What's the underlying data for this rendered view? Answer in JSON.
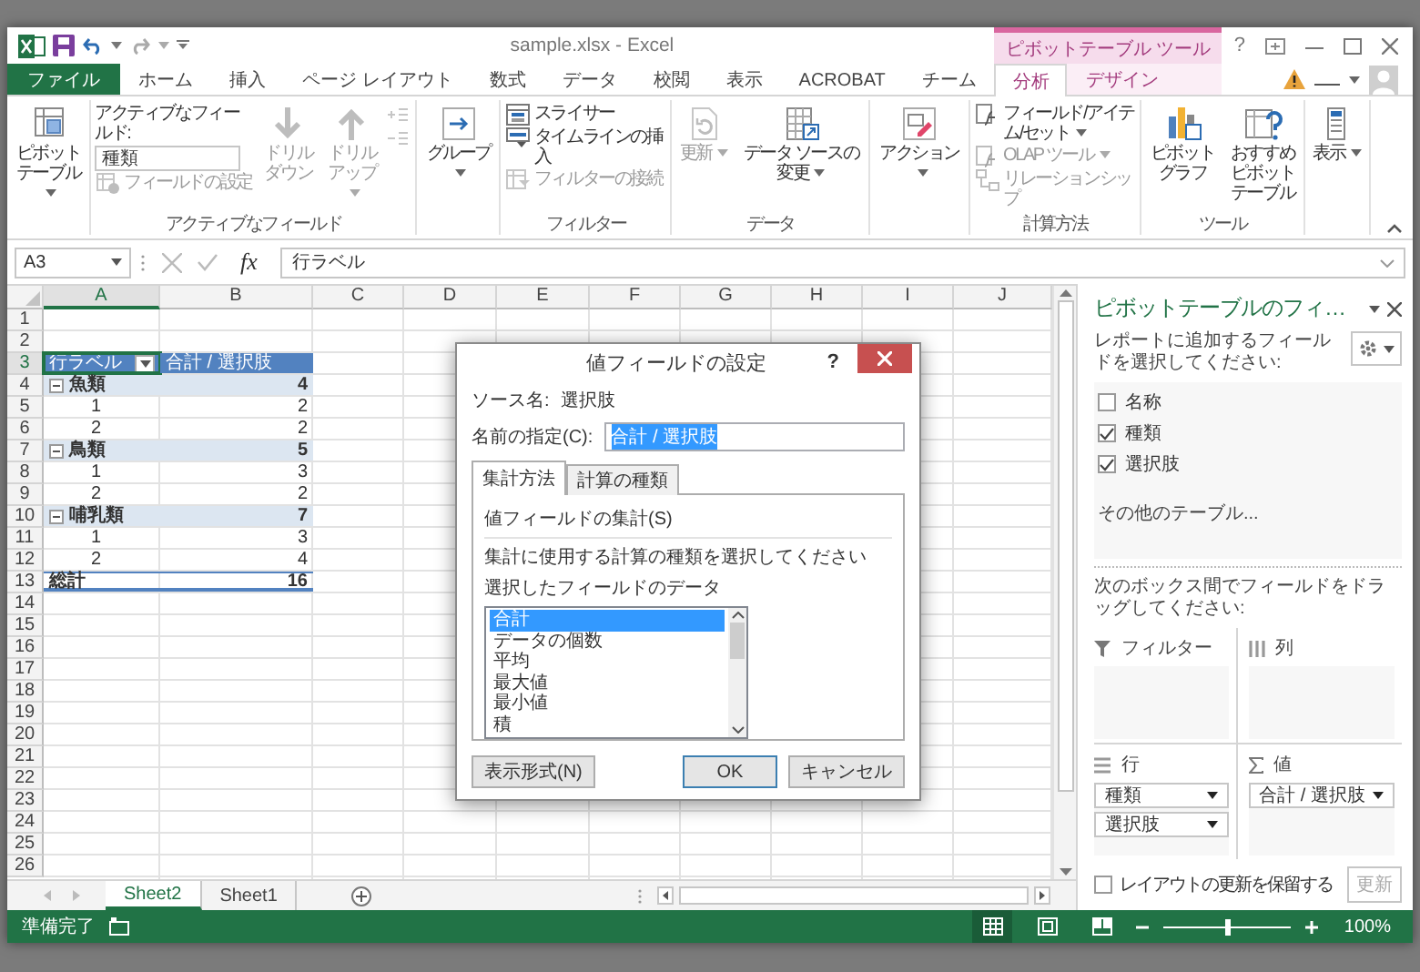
{
  "title_bar": {
    "title": "sample.xlsx - Excel",
    "context_label": "ピボットテーブル ツール",
    "help": "?"
  },
  "ribbon_tabs": [
    {
      "label": "ファイル",
      "kind": "file",
      "selected": false
    },
    {
      "label": "ホーム",
      "kind": "normal",
      "selected": false
    },
    {
      "label": "挿入",
      "kind": "normal",
      "selected": false
    },
    {
      "label": "ページ レイアウト",
      "kind": "normal",
      "selected": false
    },
    {
      "label": "数式",
      "kind": "normal",
      "selected": false
    },
    {
      "label": "データ",
      "kind": "normal",
      "selected": false
    },
    {
      "label": "校閲",
      "kind": "normal",
      "selected": false
    },
    {
      "label": "表示",
      "kind": "normal",
      "selected": false
    },
    {
      "label": "ACROBAT",
      "kind": "normal",
      "selected": false
    },
    {
      "label": "チーム",
      "kind": "normal",
      "selected": false
    },
    {
      "label": "分析",
      "kind": "context",
      "selected": true
    },
    {
      "label": "デザイン",
      "kind": "context",
      "selected": false
    }
  ],
  "ribbon_groups": [
    {
      "columns": [
        [
          {
            "kind": "large",
            "label": "ピボットテーブル",
            "dropdown": true,
            "disabled": false
          }
        ]
      ]
    },
    {
      "label": "アクティブなフィールド",
      "columns": [
        [
          {
            "kind": "caption",
            "text": "アクティブなフィールド:"
          },
          {
            "kind": "input",
            "value": "種類"
          },
          {
            "kind": "small",
            "label": "フィールドの設定",
            "dropdown": false,
            "disabled": true
          }
        ],
        [
          {
            "kind": "large",
            "label": "ドリルダウン",
            "dropdown": false,
            "disabled": true
          }
        ],
        [
          {
            "kind": "large",
            "label": "ドリルアップ",
            "dropdown": true,
            "disabled": true
          }
        ],
        [
          {
            "kind": "mini",
            "dropdown": false,
            "disabled": true
          },
          {
            "kind": "mini",
            "dropdown": false,
            "disabled": true
          }
        ]
      ]
    },
    {
      "columns": [
        [
          {
            "kind": "large",
            "label": "グループ",
            "dropdown": true,
            "disabled": false
          }
        ]
      ]
    },
    {
      "label": "フィルター",
      "columns": [
        [
          {
            "kind": "small",
            "label": "スライサー",
            "dropdown": false,
            "disabled": false
          },
          {
            "kind": "small",
            "label": "タイムラインの挿入",
            "dropdown": false,
            "disabled": false
          },
          {
            "kind": "small",
            "label": "フィルターの接続",
            "dropdown": false,
            "disabled": true
          }
        ]
      ]
    },
    {
      "label": "データ",
      "columns": [
        [
          {
            "kind": "large",
            "label": "更新",
            "dropdown": true,
            "disabled": true
          }
        ],
        [
          {
            "kind": "large",
            "label": "データ ソースの変更",
            "dropdown": true,
            "disabled": false
          }
        ]
      ]
    },
    {
      "columns": [
        [
          {
            "kind": "large",
            "label": "アクション",
            "dropdown": true,
            "disabled": false
          }
        ]
      ]
    },
    {
      "label": "計算方法",
      "columns": [
        [
          {
            "kind": "small",
            "label": "フィールド/アイテム/セット",
            "dropdown": true,
            "disabled": false
          },
          {
            "kind": "small",
            "label": "OLAP ツール",
            "dropdown": true,
            "disabled": true
          },
          {
            "kind": "small",
            "label": "リレーションシップ",
            "dropdown": false,
            "disabled": true
          }
        ]
      ]
    },
    {
      "label": "ツール",
      "columns": [
        [
          {
            "kind": "large",
            "label": "ピボットグラフ",
            "dropdown": false,
            "disabled": false
          }
        ],
        [
          {
            "kind": "large",
            "label": "おすすめピボットテーブル",
            "dropdown": false,
            "disabled": false
          }
        ]
      ]
    },
    {
      "columns": [
        [
          {
            "kind": "large",
            "label": "表示",
            "dropdown": true,
            "disabled": false
          }
        ]
      ]
    }
  ],
  "formula_bar": {
    "name_box": "A3",
    "function_symbol": "fx",
    "formula": "行ラベル"
  },
  "sheet": {
    "columns": [
      {
        "label": "A",
        "selected": true
      },
      {
        "label": "B",
        "selected": false
      },
      {
        "label": "C",
        "selected": false
      },
      {
        "label": "D",
        "selected": false
      },
      {
        "label": "E",
        "selected": false
      },
      {
        "label": "F",
        "selected": false
      },
      {
        "label": "G",
        "selected": false
      },
      {
        "label": "H",
        "selected": false
      },
      {
        "label": "I",
        "selected": false
      },
      {
        "label": "J",
        "selected": false
      }
    ],
    "rows": [
      {
        "number": "1",
        "selected": false
      },
      {
        "number": "2",
        "selected": false
      },
      {
        "number": "3",
        "selected": true,
        "kind": "header",
        "cells": [
          "行ラベル",
          "合計 / 選択肢"
        ]
      },
      {
        "number": "4",
        "selected": false,
        "kind": "group",
        "expanded": true,
        "cells": [
          "魚類",
          "4"
        ]
      },
      {
        "number": "5",
        "selected": false,
        "kind": "item",
        "cells": [
          "1",
          "2"
        ]
      },
      {
        "number": "6",
        "selected": false,
        "kind": "item",
        "cells": [
          "2",
          "2"
        ]
      },
      {
        "number": "7",
        "selected": false,
        "kind": "group",
        "expanded": true,
        "cells": [
          "鳥類",
          "5"
        ]
      },
      {
        "number": "8",
        "selected": false,
        "kind": "item",
        "cells": [
          "1",
          "3"
        ]
      },
      {
        "number": "9",
        "selected": false,
        "kind": "item",
        "cells": [
          "2",
          "2"
        ]
      },
      {
        "number": "10",
        "selected": false,
        "kind": "group",
        "expanded": true,
        "cells": [
          "哺乳類",
          "7"
        ]
      },
      {
        "number": "11",
        "selected": false,
        "kind": "item",
        "cells": [
          "1",
          "3"
        ]
      },
      {
        "number": "12",
        "selected": false,
        "kind": "item",
        "cells": [
          "2",
          "4"
        ]
      },
      {
        "number": "13",
        "selected": false,
        "kind": "total",
        "cells": [
          "総計",
          "16"
        ]
      },
      {
        "number": "14",
        "selected": false
      },
      {
        "number": "15",
        "selected": false
      },
      {
        "number": "16",
        "selected": false
      },
      {
        "number": "17",
        "selected": false
      },
      {
        "number": "18",
        "selected": false
      },
      {
        "number": "19",
        "selected": false
      },
      {
        "number": "20",
        "selected": false
      },
      {
        "number": "21",
        "selected": false
      },
      {
        "number": "22",
        "selected": false
      },
      {
        "number": "23",
        "selected": false
      },
      {
        "number": "24",
        "selected": false
      },
      {
        "number": "25",
        "selected": false
      },
      {
        "number": "26",
        "selected": false
      }
    ]
  },
  "sheet_tabs": [
    {
      "label": "Sheet2",
      "selected": true
    },
    {
      "label": "Sheet1",
      "selected": false
    }
  ],
  "dialog": {
    "title": "値フィールドの設定",
    "help": "?",
    "source_label": "ソース名:",
    "source_value": "選択肢",
    "name_field": {
      "label": "名前の指定(C):",
      "value": "合計 / 選択肢",
      "selected": true
    },
    "tabs": [
      {
        "label": "集計方法",
        "selected": true
      },
      {
        "label": "計算の種類",
        "selected": false
      }
    ],
    "section": "値フィールドの集計(S)",
    "instruction": "集計に使用する計算の種類を選択してください",
    "list_label": "選択したフィールドのデータ",
    "functions": [
      {
        "label": "合計",
        "selected": true
      },
      {
        "label": "データの個数",
        "selected": false
      },
      {
        "label": "平均",
        "selected": false
      },
      {
        "label": "最大値",
        "selected": false
      },
      {
        "label": "最小値",
        "selected": false
      },
      {
        "label": "積",
        "selected": false
      }
    ],
    "buttons": [
      {
        "label": "表示形式(N)",
        "kind": "normal"
      },
      {
        "label": "OK",
        "kind": "default"
      },
      {
        "label": "キャンセル",
        "kind": "normal"
      }
    ]
  },
  "pivot_pane": {
    "title": "ピボットテーブルのフィ…",
    "subtitle": "レポートに追加するフィールドを選択してください:",
    "fields": [
      {
        "label": "名称",
        "checked": false
      },
      {
        "label": "種類",
        "checked": true
      },
      {
        "label": "選択肢",
        "checked": true
      }
    ],
    "more_tables": "その他のテーブル...",
    "instruction": "次のボックス間でフィールドをドラッグしてください:",
    "areas": [
      {
        "label": "フィルター",
        "kind": "filter"
      },
      {
        "label": "列",
        "kind": "columns"
      },
      {
        "label": "行",
        "kind": "rows",
        "items": [
          "種類",
          "選択肢"
        ]
      },
      {
        "label": "値",
        "kind": "values",
        "items": [
          "合計 / 選択肢"
        ]
      }
    ],
    "defer": {
      "label": "レイアウトの更新を保留する",
      "checked": false
    },
    "update_button": {
      "label": "更新",
      "disabled": true
    }
  },
  "status_bar": {
    "text": "準備完了",
    "views": [
      {
        "selected": true
      },
      {
        "selected": false
      },
      {
        "selected": false
      }
    ],
    "zoom": {
      "level": 0.5,
      "reading": "100%"
    }
  }
}
